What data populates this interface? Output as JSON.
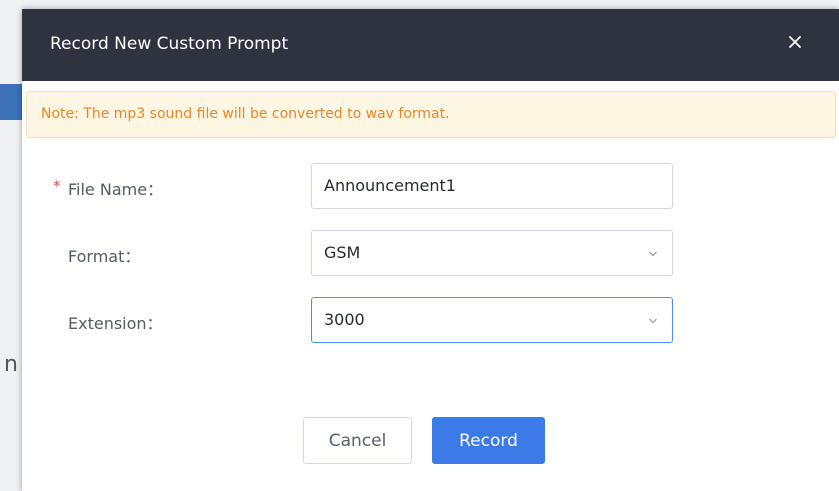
{
  "dialog": {
    "title": "Record New Custom Prompt",
    "close_icon": "close-icon"
  },
  "note": {
    "text": "Note: The mp3 sound file will be converted to wav format."
  },
  "form": {
    "file_name": {
      "label": "File Name：",
      "required": true,
      "value": "Announcement1"
    },
    "format": {
      "label": "Format：",
      "value": "GSM"
    },
    "extension": {
      "label": "Extension：",
      "value": "3000"
    }
  },
  "buttons": {
    "cancel_label": "Cancel",
    "record_label": "Record"
  },
  "colors": {
    "header_bg": "#2f3340",
    "note_text": "#e8872a",
    "primary": "#3a7be8",
    "required": "#e5484d"
  }
}
